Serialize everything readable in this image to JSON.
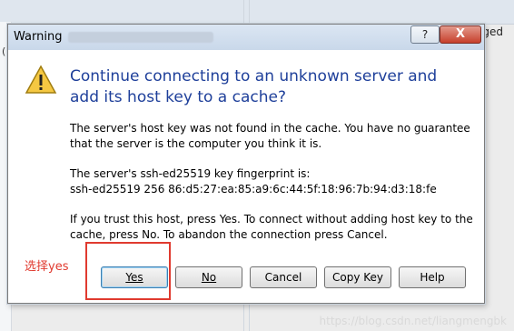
{
  "background": {
    "right_label": "ged",
    "left_tab": "("
  },
  "dialog": {
    "title": "Warning",
    "help_label": "?",
    "close_label": "X",
    "headline": "Continue connecting to an unknown server and add its host key to a cache?",
    "paragraph1": "The server's host key was not found in the cache. You have no guarantee that the server is the computer you think it is.",
    "paragraph2_line1": "The server's ssh-ed25519 key fingerprint is:",
    "paragraph2_line2": "ssh-ed25519 256 86:d5:27:ea:85:a9:6c:44:5f:18:96:7b:94:d3:18:fe",
    "paragraph3": "If you trust this host, press Yes. To connect without adding host key to the cache, press No. To abandon the connection press Cancel.",
    "buttons": {
      "yes": "Yes",
      "no": "No",
      "cancel": "Cancel",
      "copy_key": "Copy Key",
      "help": "Help"
    }
  },
  "annotation": {
    "label": "选择yes",
    "color": "#e03a2f"
  },
  "watermark": "https://blog.csdn.net/liangmengbk"
}
